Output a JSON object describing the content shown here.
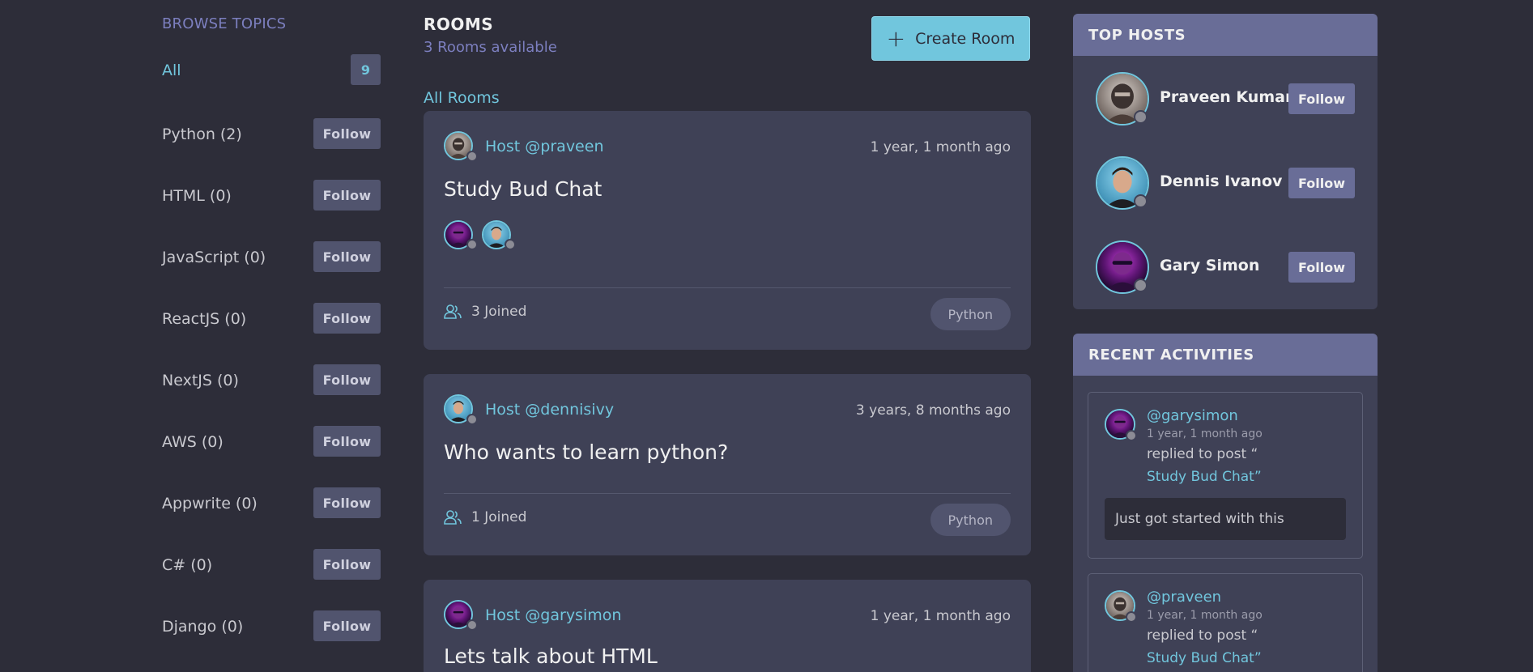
{
  "topics": {
    "title": "BROWSE TOPICS",
    "all": {
      "label": "All",
      "count": "9"
    },
    "items": [
      {
        "label": "Python (2)",
        "follow": "Follow"
      },
      {
        "label": "HTML (0)",
        "follow": "Follow"
      },
      {
        "label": "JavaScript (0)",
        "follow": "Follow"
      },
      {
        "label": "ReactJS (0)",
        "follow": "Follow"
      },
      {
        "label": "NextJS (0)",
        "follow": "Follow"
      },
      {
        "label": "AWS (0)",
        "follow": "Follow"
      },
      {
        "label": "Appwrite (0)",
        "follow": "Follow"
      },
      {
        "label": "C# (0)",
        "follow": "Follow"
      },
      {
        "label": "Django (0)",
        "follow": "Follow"
      }
    ]
  },
  "rooms": {
    "title": "ROOMS",
    "subtitle": "3 Rooms available",
    "create_label": "Create Room",
    "filter_label": "All Rooms",
    "cards": [
      {
        "host": "Host @praveen",
        "time": "1 year, 1 month ago",
        "title": "Study Bud Chat",
        "joined": "3 Joined",
        "tag": "Python",
        "avatar": "praveen",
        "participants": [
          "gary",
          "dennis"
        ]
      },
      {
        "host": "Host @dennisivy",
        "time": "3 years, 8 months ago",
        "title": "Who wants to learn python?",
        "joined": "1 Joined",
        "tag": "Python",
        "avatar": "dennis"
      },
      {
        "host": "Host @garysimon",
        "time": "1 year, 1 month ago",
        "title": "Lets talk about HTML",
        "avatar": "gary"
      }
    ]
  },
  "top_hosts": {
    "title": "TOP HOSTS",
    "hosts": [
      {
        "name": "Praveen Kumar",
        "follow": "Follow",
        "avatar": "praveen"
      },
      {
        "name": "Dennis Ivanov",
        "follow": "Follow",
        "avatar": "dennis"
      },
      {
        "name": "Gary Simon",
        "follow": "Follow",
        "avatar": "gary"
      }
    ]
  },
  "activities": {
    "title": "RECENT ACTIVITIES",
    "items": [
      {
        "user": "@garysimon",
        "time": "1 year, 1 month ago",
        "action": "replied to post “",
        "target": "Study Bud Chat”",
        "quote": "Just got started with this",
        "avatar": "gary"
      },
      {
        "user": "@praveen",
        "time": "1 year, 1 month ago",
        "action": "replied to post “",
        "target": "Study Bud Chat”",
        "avatar": "praveen"
      }
    ]
  },
  "colors": {
    "background": "#2d2d39",
    "card": "#3f4156",
    "accent": "#71c6dd",
    "panel_header": "#696d97"
  },
  "icons": {
    "create": "plus-icon",
    "joined": "users-icon",
    "status": "online-status-icon"
  }
}
